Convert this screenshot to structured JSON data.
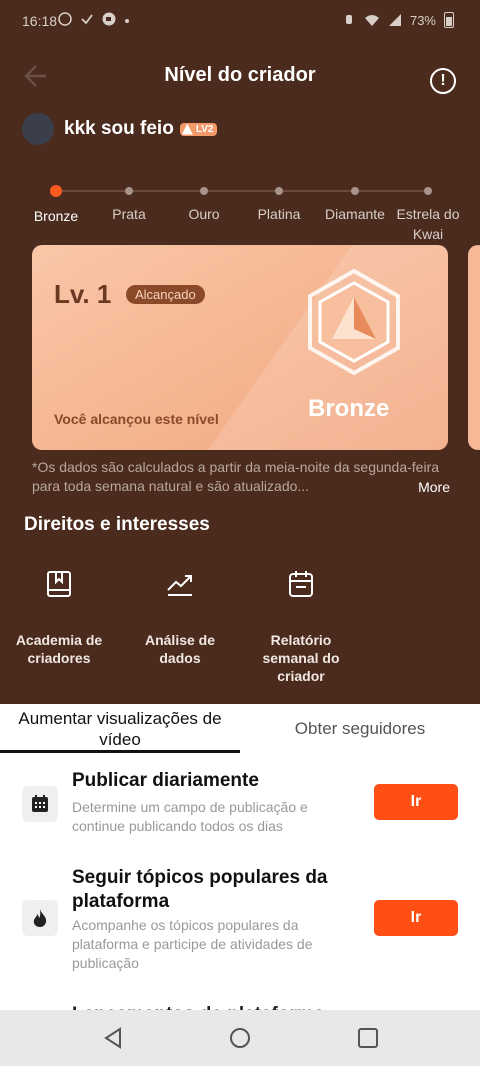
{
  "status_bar": {
    "time": "16:18",
    "battery": "73%",
    "left_icons": [
      "whatsapp-icon",
      "check-icon",
      "camera-icon",
      "dot-icon"
    ],
    "right_icons": [
      "mute-icon",
      "wifi-icon",
      "signal-icon",
      "battery-icon"
    ]
  },
  "header": {
    "title": "Nível do criador"
  },
  "user": {
    "name": "kkk sou feio",
    "level_badge": "LV2"
  },
  "levels": [
    {
      "label": "Bronze",
      "active": true
    },
    {
      "label": "Prata",
      "active": false
    },
    {
      "label": "Ouro",
      "active": false
    },
    {
      "label": "Platina",
      "active": false
    },
    {
      "label": "Diamante",
      "active": false
    },
    {
      "label": "Estrela do Kwai",
      "active": false
    }
  ],
  "card": {
    "level": "Lv. 1",
    "status_badge": "Alcançado",
    "tier_name": "Bronze",
    "reached_text": "Você alcançou este nível"
  },
  "note": {
    "text": "*Os dados são calculados a partir da meia-noite da segunda-feira para toda semana natural e são atualizado...",
    "more": "More"
  },
  "rights": {
    "title": "Direitos e interesses",
    "items": [
      {
        "label": "Academia de criadores",
        "icon": "book-icon"
      },
      {
        "label": "Análise de dados",
        "icon": "trend-icon"
      },
      {
        "label": "Relatório semanal do criador",
        "icon": "calendar-icon"
      }
    ]
  },
  "tabs": [
    {
      "label": "Aumentar visualizações de vídeo",
      "active": true
    },
    {
      "label": "Obter seguidores",
      "active": false
    }
  ],
  "tasks": [
    {
      "title": "Publicar diariamente",
      "desc": "Determine um campo de publicação e continue publicando todos os dias",
      "button": "Ir",
      "icon": "calendar-icon"
    },
    {
      "title": "Seguir tópicos populares da plataforma",
      "desc": "Acompanhe os tópicos populares da plataforma e participe de atividades de publicação",
      "button": "Ir",
      "icon": "fire-icon"
    }
  ],
  "task_partial": "Lançamentos da plataforma",
  "colors": {
    "background": "#4a2b1e",
    "accent": "#ff4f14",
    "card": "#f4b08a"
  }
}
